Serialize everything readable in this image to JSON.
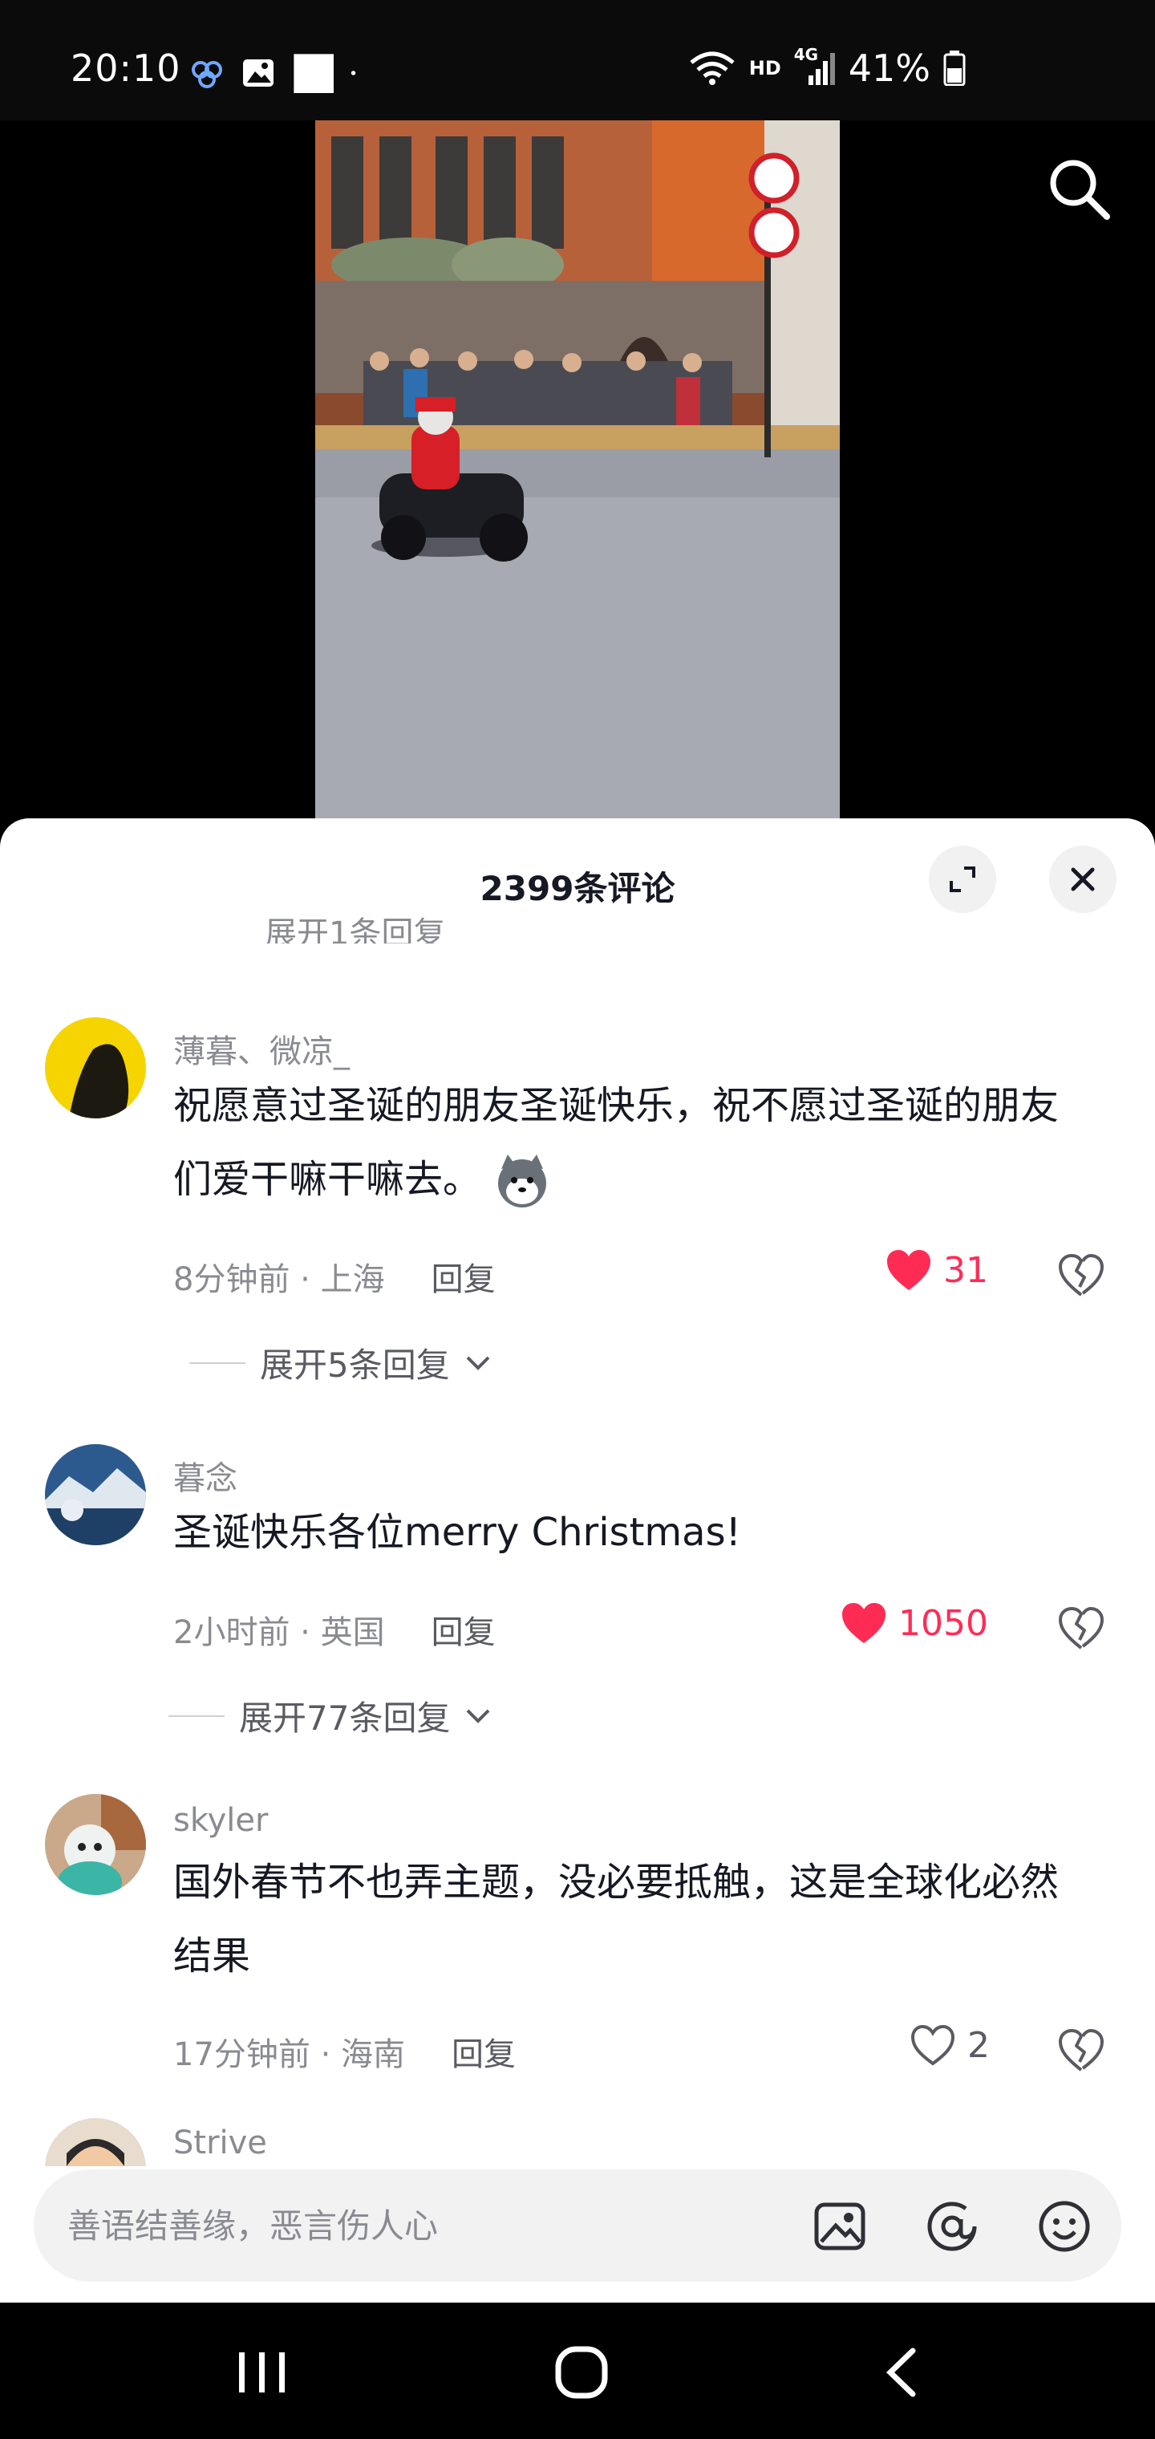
{
  "status_bar": {
    "time": "20:10",
    "network_hd": "HD",
    "network_type": "4G",
    "battery": "41%"
  },
  "video": {
    "search_icon": "search-icon",
    "sign_icons": [
      "no-entry-sign",
      "no-entry-sign"
    ]
  },
  "comments_panel": {
    "title": "2399条评论",
    "partial_expand_text": "展开1条回复",
    "comments": [
      {
        "username": "薄暮、微凉_",
        "text": "祝愿意过圣诞的朋友圣诞快乐，祝不愿过圣诞的朋友们爱干嘛干嘛去。",
        "time_location": "8分钟前 · 上海",
        "reply_label": "回复",
        "likes": "31",
        "liked": true,
        "expand_replies": "展开5条回复"
      },
      {
        "username": "暮念",
        "text": "圣诞快乐各位merry Christmas!",
        "time_location": "2小时前 · 英国",
        "reply_label": "回复",
        "likes": "1050",
        "liked": true,
        "expand_replies": "展开77条回复"
      },
      {
        "username": "skyler",
        "text": "国外春节不也弄主题，没必要抵触，这是全球化必然结果",
        "time_location": "17分钟前 · 海南",
        "reply_label": "回复",
        "likes": "2",
        "liked": false
      },
      {
        "username": "Strive"
      }
    ]
  },
  "input": {
    "placeholder": "善语结善缘，恶言伤人心",
    "icons": [
      "image-icon",
      "at-icon",
      "emoji-icon"
    ]
  },
  "colors": {
    "like_red": "#fe2c55",
    "text_primary": "#161823",
    "text_secondary": "#8a8b91"
  }
}
